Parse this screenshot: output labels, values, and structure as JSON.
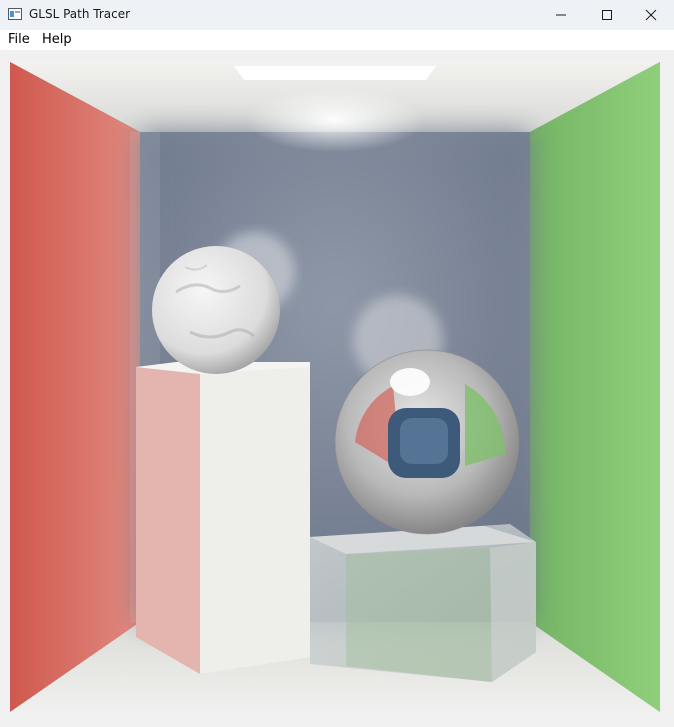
{
  "window": {
    "title": "GLSL Path Tracer",
    "controls": [
      "minimize",
      "maximize",
      "close"
    ]
  },
  "menu": {
    "items": [
      "File",
      "Help"
    ]
  },
  "viewport": {
    "content": "path-traced-render",
    "colors": {
      "left_wall": "#cf5a50",
      "right_wall": "#7cbf6a",
      "back_wall": "#7a8598",
      "floor": "#e4e4e2",
      "ceiling": "#e6e6e3",
      "light": "#ffffff"
    }
  }
}
